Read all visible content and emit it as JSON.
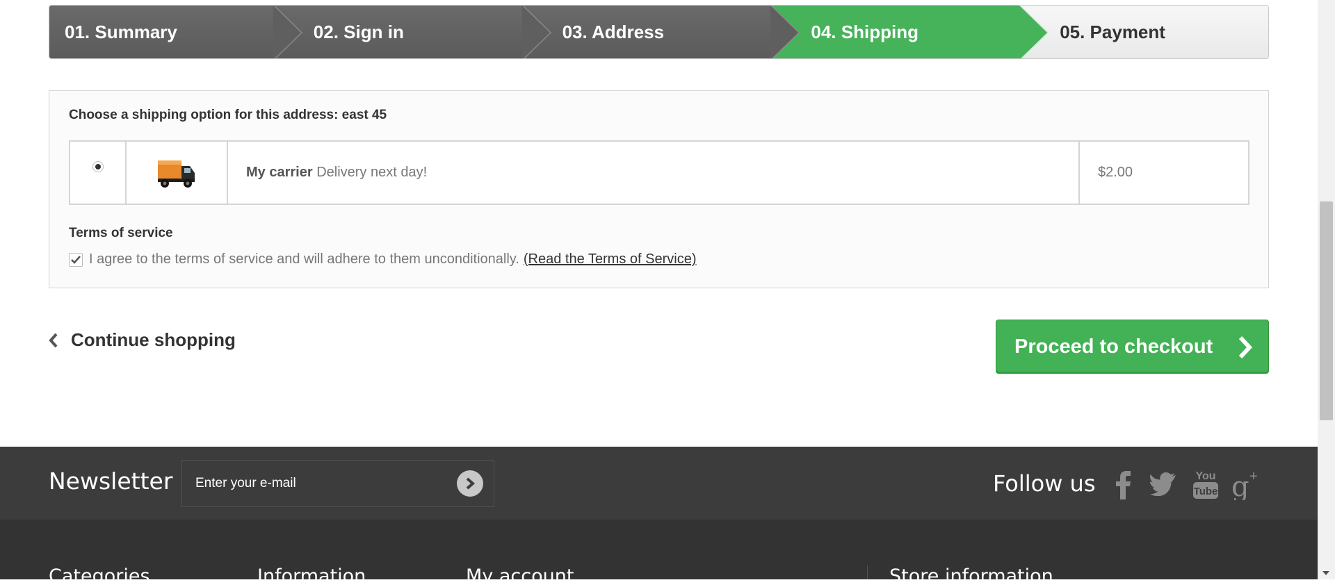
{
  "steps": [
    {
      "label": "01. Summary",
      "state": "done"
    },
    {
      "label": "02. Sign in",
      "state": "done"
    },
    {
      "label": "03. Address",
      "state": "done"
    },
    {
      "label": "04. Shipping",
      "state": "current"
    },
    {
      "label": "05. Payment",
      "state": "todo"
    }
  ],
  "shipping": {
    "title": "Choose a shipping option for this address: east 45",
    "carrier": {
      "selected": true,
      "name": "My carrier",
      "delay": "Delivery next day!",
      "price": "$2.00",
      "icon": "delivery-truck-icon"
    },
    "tos_title": "Terms of service",
    "tos_agreed": true,
    "tos_text": "I agree to the terms of service and will adhere to them unconditionally.",
    "tos_link": "(Read the Terms of Service)"
  },
  "actions": {
    "continue_label": "Continue shopping",
    "checkout_label": "Proceed to checkout"
  },
  "footer": {
    "newsletter_title": "Newsletter",
    "newsletter_placeholder": "Enter your e-mail",
    "follow_title": "Follow us",
    "social": [
      "facebook-icon",
      "twitter-icon",
      "youtube-icon",
      "google-plus-icon"
    ],
    "columns": [
      "Categories",
      "Information",
      "My account",
      "Store information"
    ]
  },
  "colors": {
    "accent_green": "#46b35a",
    "step_done": "#5f5f5f",
    "footer_dark": "#333333"
  }
}
